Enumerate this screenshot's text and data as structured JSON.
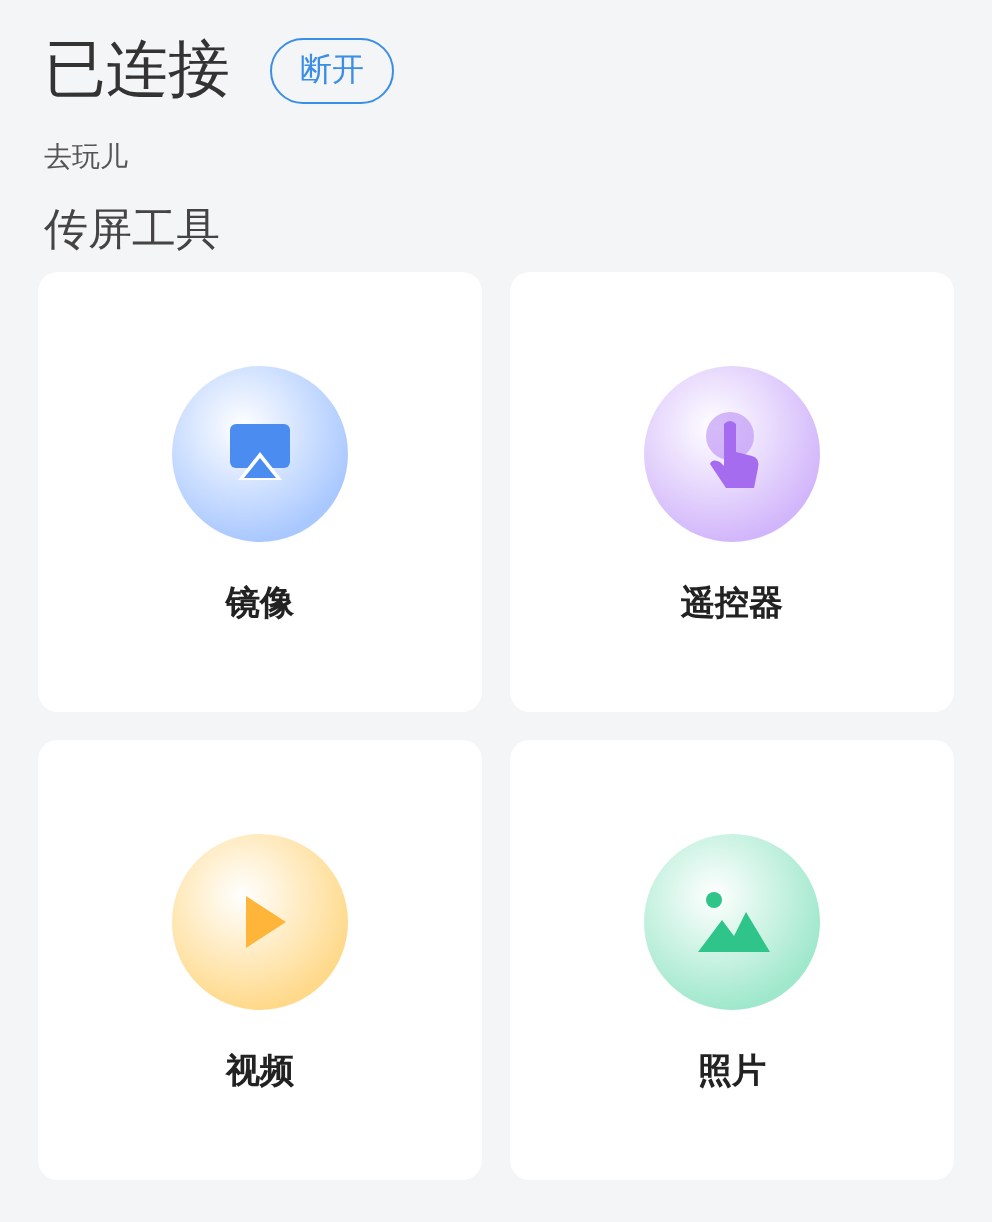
{
  "status": {
    "title": "已连接",
    "disconnect_button": "断开",
    "device": "去玩儿"
  },
  "section_title": "传屏工具",
  "tools": [
    {
      "label": "镜像",
      "kind": "mirror",
      "color": "#a9c8ff"
    },
    {
      "label": "遥控器",
      "kind": "remote",
      "color": "#d2b6fb"
    },
    {
      "label": "视频",
      "kind": "video",
      "color": "#ffd98a"
    },
    {
      "label": "照片",
      "kind": "photo",
      "color": "#9fe8cc"
    }
  ]
}
